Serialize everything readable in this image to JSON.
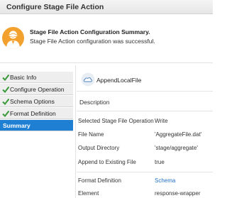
{
  "window": {
    "title": "Configure Stage File Action"
  },
  "summary": {
    "title": "Stage File Action Configuration Summary.",
    "message": "Stage File Action configuration was successful.",
    "colors": {
      "avatar_bg": "#f3a12e"
    }
  },
  "sidebar": {
    "items": [
      {
        "label": "Basic Info",
        "completed": true
      },
      {
        "label": "Configure Operation",
        "completed": true
      },
      {
        "label": "Schema Options",
        "completed": true
      },
      {
        "label": "Format Definition",
        "completed": true
      },
      {
        "label": "Summary",
        "active": true
      }
    ],
    "colors": {
      "active_bg": "#1f7fd3",
      "check": "#3a9a3a"
    }
  },
  "details": {
    "file_name": "AppendLocalFile",
    "description_label": "Description",
    "rows": [
      {
        "label": "Selected Stage File Operation",
        "value": "Write"
      },
      {
        "label": "File Name",
        "value": "'AggregateFile.dat'"
      },
      {
        "label": "Output Directory",
        "value": "'stage/aggregate'"
      },
      {
        "label": "Append to Existing File",
        "value": "true"
      },
      {
        "label": "Format Definition",
        "value": "Schema"
      },
      {
        "label": "Element",
        "value": "response-wrapper"
      }
    ]
  }
}
